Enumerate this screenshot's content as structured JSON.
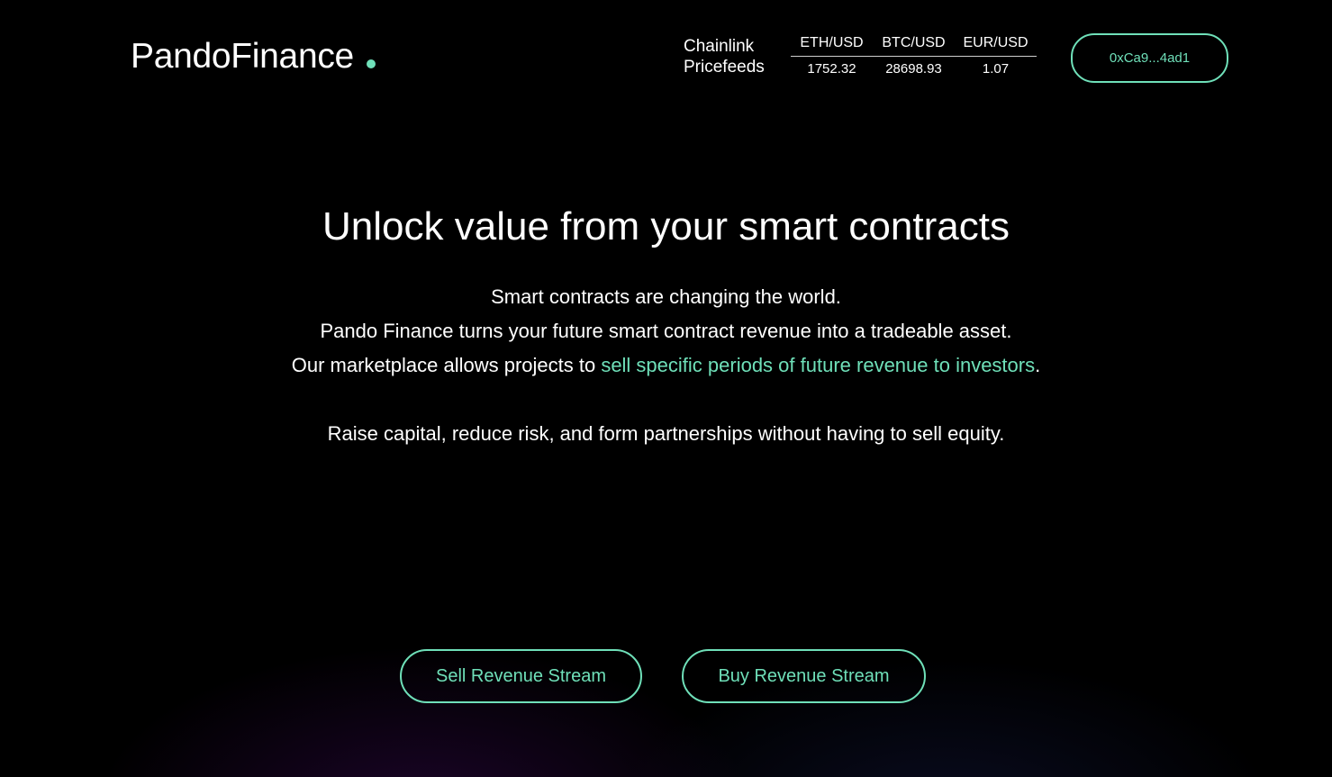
{
  "brand": {
    "name": "PandoFinance",
    "accent_color": "#6fe0b9"
  },
  "pricefeeds": {
    "label_line1": "Chainlink",
    "label_line2": "Pricefeeds",
    "pairs": [
      {
        "pair": "ETH/USD",
        "value": "1752.32"
      },
      {
        "pair": "BTC/USD",
        "value": "28698.93"
      },
      {
        "pair": "EUR/USD",
        "value": "1.07"
      }
    ]
  },
  "wallet": {
    "address": "0xCa9...4ad1"
  },
  "hero": {
    "title": "Unlock value from your smart contracts",
    "line1": "Smart contracts are changing the world.",
    "line2": "Pando Finance turns your future smart contract revenue into a tradeable asset.",
    "line3_prefix": "Our marketplace allows projects to ",
    "line3_highlight": "sell specific periods of future revenue to investors",
    "line3_suffix": ".",
    "line4": "Raise capital, reduce risk, and form partnerships without having to sell equity."
  },
  "actions": {
    "sell_label": "Sell Revenue Stream",
    "buy_label": "Buy Revenue Stream"
  }
}
